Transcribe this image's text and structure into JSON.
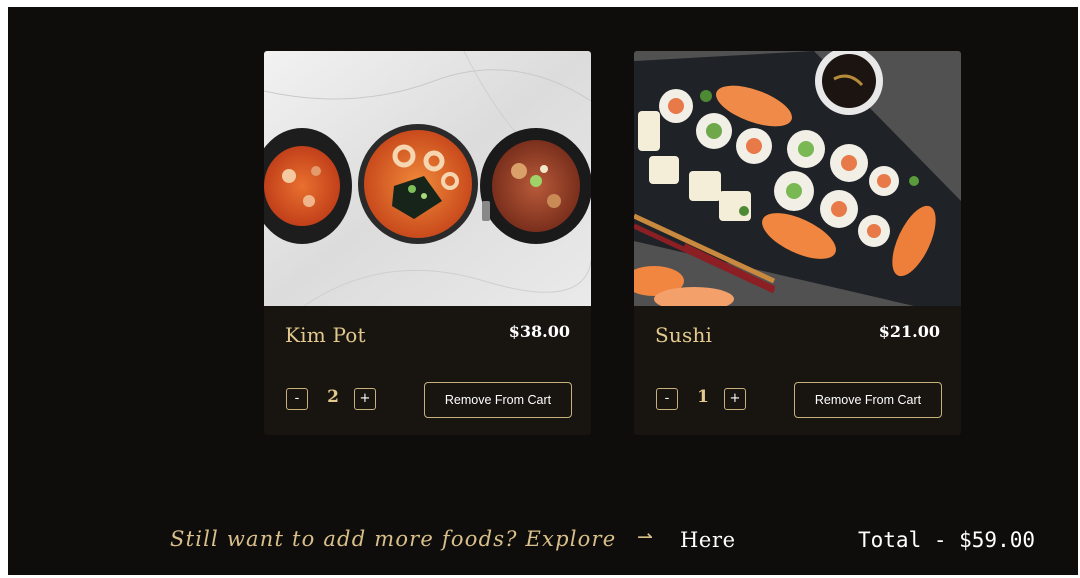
{
  "cart": {
    "items": [
      {
        "name": "Kim Pot",
        "price": "$38.00",
        "quantity": "2",
        "minus_label": "-",
        "plus_label": "+",
        "remove_label": "Remove From Cart"
      },
      {
        "name": "Sushi",
        "price": "$21.00",
        "quantity": "1",
        "minus_label": "-",
        "plus_label": "+",
        "remove_label": "Remove From Cart"
      }
    ]
  },
  "footer": {
    "explore_text": "Still want to add more foods? Explore",
    "arrow": "⇀",
    "here_link": "Here",
    "total": "Total - $59.00"
  },
  "colors": {
    "background": "#0f0d0b",
    "card": "#181511",
    "accent_gold": "#e3c98d",
    "button_border": "#c8b07a"
  }
}
